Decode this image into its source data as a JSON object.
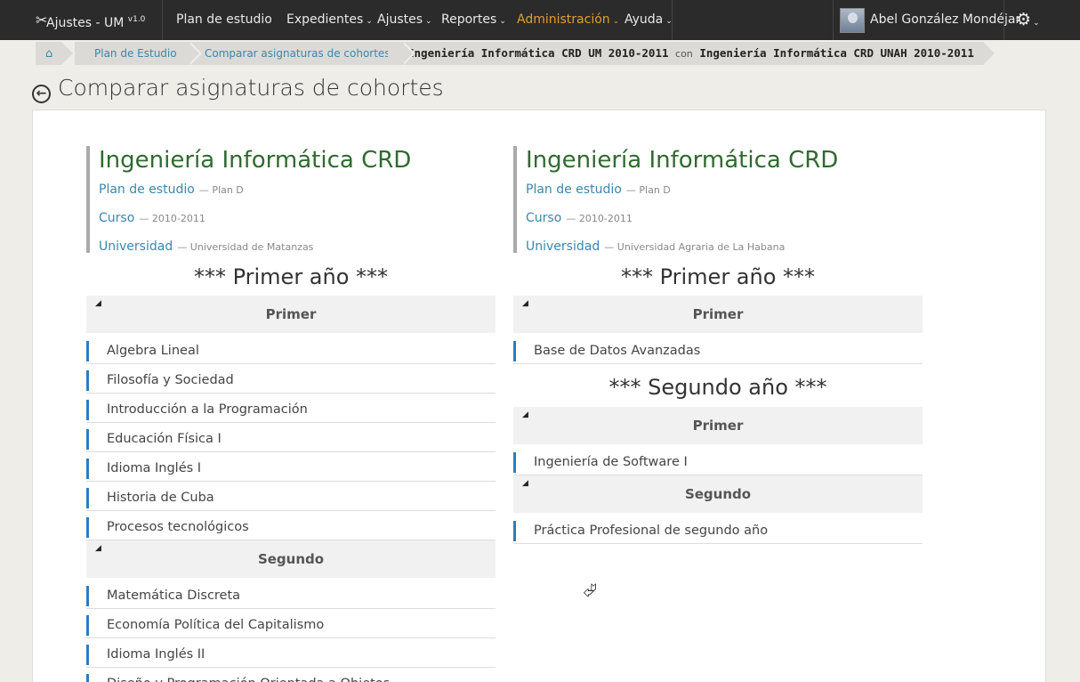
{
  "navbar": {
    "brand": "Ajustes - UM",
    "version": "v1.0",
    "items": [
      {
        "label": "Plan de estudio"
      },
      {
        "label": "Expedientes"
      },
      {
        "label": "Ajustes"
      },
      {
        "label": "Reportes"
      },
      {
        "label": "Administración"
      },
      {
        "label": "Ayuda"
      }
    ],
    "user": "Abel González Mondéjar"
  },
  "breadcrumb": {
    "items": [
      "Plan de Estudio",
      "Comparar asignaturas de cohortes"
    ],
    "current_a": "Ingeniería Informática CRD UM 2010-2011",
    "current_con": "con",
    "current_b": "Ingeniería Informática CRD UNAH 2010-2011"
  },
  "page_title": "Comparar asignaturas de cohortes",
  "left": {
    "title": "Ingeniería Informática CRD",
    "plan_label": "Plan de estudio",
    "plan_value": "— Plan D",
    "curso_label": "Curso",
    "curso_value": "— 2010-2011",
    "uni_label": "Universidad",
    "uni_value": "— Universidad de Matanzas",
    "year1": "*** Primer año ***",
    "term1": "Primer",
    "term1_subjects": [
      "Algebra Lineal",
      "Filosofía y Sociedad",
      "Introducción a la Programación",
      "Educación Física I",
      "Idioma Inglés I",
      "Historia de Cuba",
      "Procesos tecnológicos"
    ],
    "term2": "Segundo",
    "term2_subjects": [
      "Matemática Discreta",
      "Economía Política del Capitalismo",
      "Idioma Inglés II",
      "Diseño y Programación Orientada a Objetos"
    ]
  },
  "right": {
    "title": "Ingeniería Informática CRD",
    "plan_label": "Plan de estudio",
    "plan_value": "— Plan D",
    "curso_label": "Curso",
    "curso_value": "— 2010-2011",
    "uni_label": "Universidad",
    "uni_value": "— Universidad Agraria de La Habana",
    "year1": "*** Primer año ***",
    "y1_term1": "Primer",
    "y1_term1_subjects": [
      "Base de Datos Avanzadas"
    ],
    "year2": "*** Segundo año ***",
    "y2_term1": "Primer",
    "y2_term1_subjects": [
      "Ingeniería de Software I"
    ],
    "y2_term2": "Segundo",
    "y2_term2_subjects": [
      "Práctica Profesional de segundo año"
    ]
  },
  "icons": {
    "brand": "scissors-icon",
    "home": "home-icon",
    "back": "circle-arrow-left-icon",
    "settings": "gear-icon",
    "collapse": "triangle-collapse-icon",
    "cursor": "mouse-pointer-icon"
  },
  "colors": {
    "navbar_bg": "#2b2b2b",
    "active_menu": "#e0a12a",
    "link": "#3a87ad",
    "title_green": "#2f6b2f",
    "subject_bar": "#2d7cbf"
  }
}
